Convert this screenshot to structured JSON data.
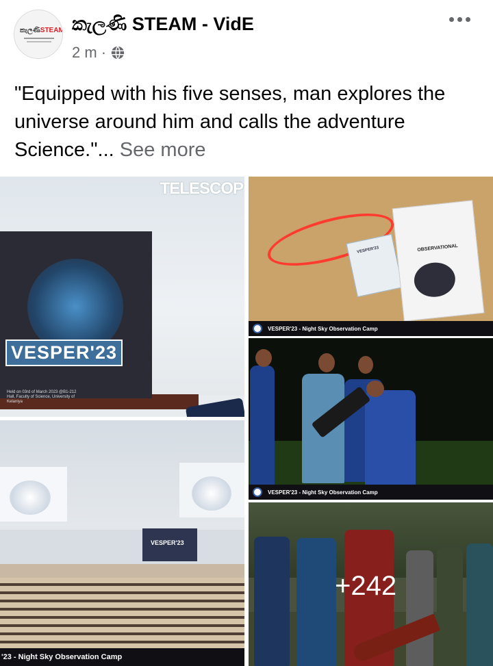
{
  "post": {
    "page_name": "කැලණි STEAM - VidE",
    "time": "2 m",
    "separator": "·",
    "text": "\"Equipped with his five senses, man explores the universe around him and calls the adventure Science.\"...",
    "see_more": "See more",
    "avatar": {
      "logo_prefix": "කැලණි",
      "logo_suffix": "STEAM"
    }
  },
  "photos": [
    {
      "banner_title": "VESPER'23",
      "wall_sign": "TELESCOP",
      "banner_note": "Held on 03rd of March 2023 @B1-212 Hall, Faculty of Science, University of Kelaniya"
    },
    {
      "caption": "VESPER'23 - Night Sky Observation Camp",
      "brochure_title": "OBSERVATIONAL",
      "card_label": "VESPER'23"
    },
    {
      "caption": "VESPER'23 - Night Sky Observation Camp"
    },
    {
      "caption": "'23 - Night Sky Observation Camp",
      "center_banner": "VESPER'23"
    },
    {
      "more_count": "+242"
    }
  ],
  "icons": {
    "globe": "globe-icon",
    "more": "more-options-icon"
  },
  "colors": {
    "secondary_text": "#65676b",
    "primary_text": "#050505"
  }
}
